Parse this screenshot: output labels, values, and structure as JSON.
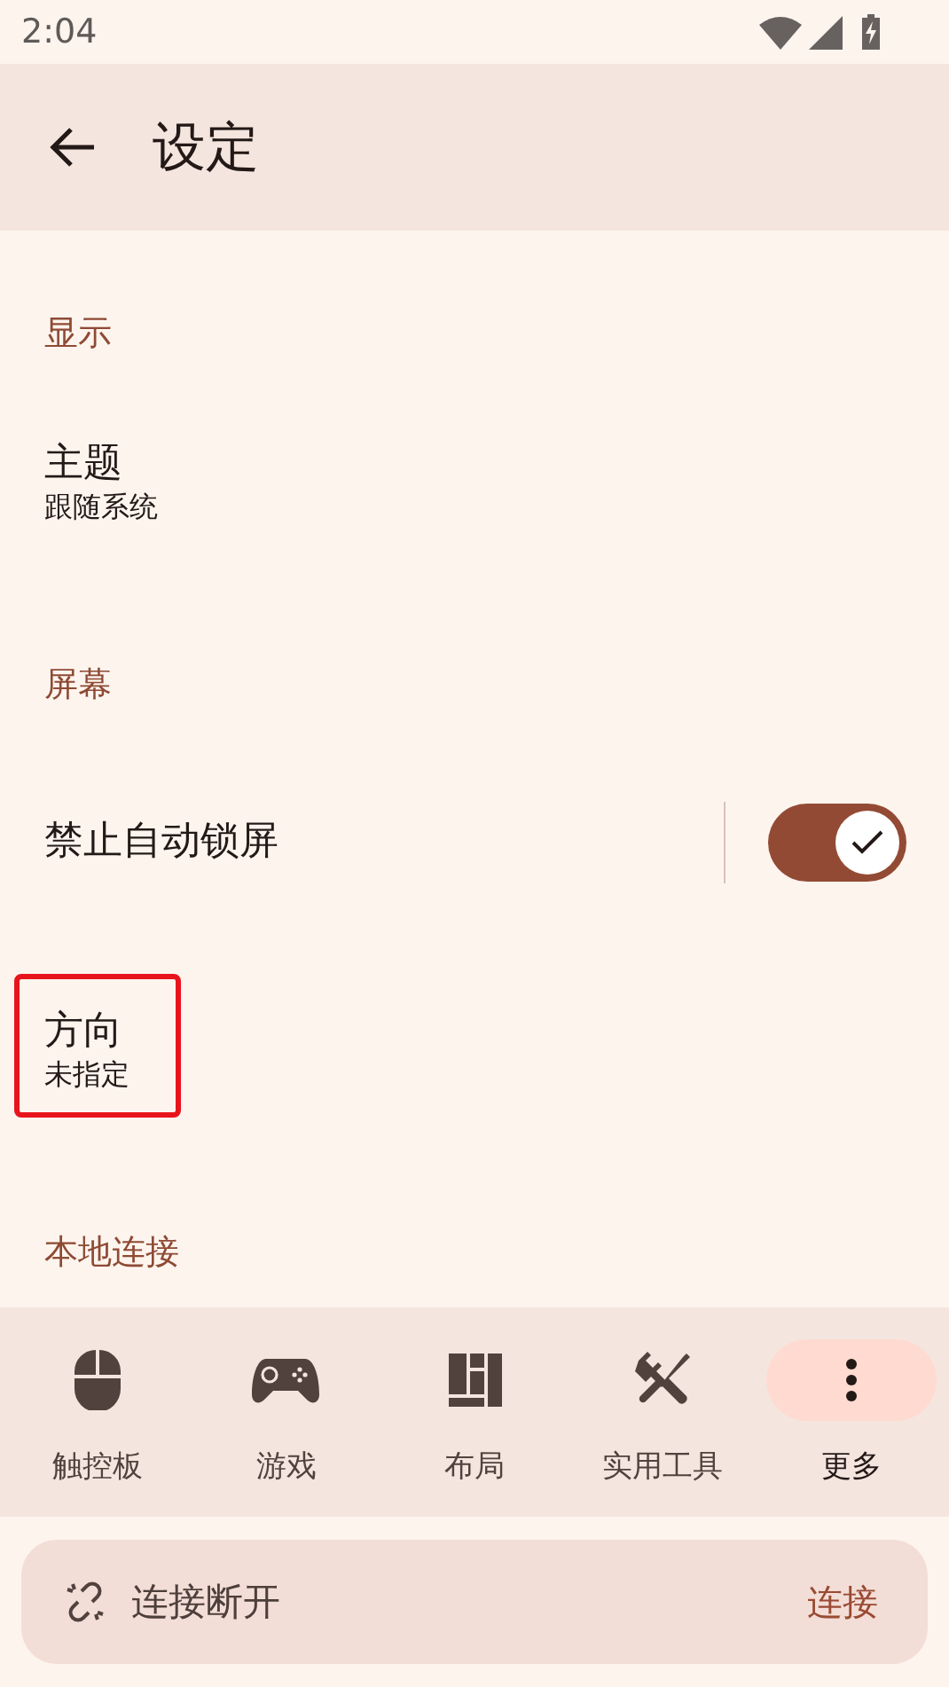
{
  "status_bar": {
    "time": "2:04"
  },
  "app_bar": {
    "title": "设定"
  },
  "sections": [
    {
      "header": "显示",
      "items": [
        {
          "kind": "text",
          "title": "主题",
          "summary": "跟随系统",
          "highlighted": false
        }
      ]
    },
    {
      "header": "屏幕",
      "items": [
        {
          "kind": "switch",
          "title": "禁止自动锁屏",
          "on": true
        },
        {
          "kind": "text",
          "title": "方向",
          "summary": "未指定",
          "highlighted": true
        }
      ]
    },
    {
      "header": "本地连接"
    }
  ],
  "nav": [
    {
      "kind": "mouse",
      "label": "触控板",
      "selected": false
    },
    {
      "kind": "gamepad",
      "label": "游戏",
      "selected": false
    },
    {
      "kind": "layout",
      "label": "布局",
      "selected": false
    },
    {
      "kind": "tools",
      "label": "实用工具",
      "selected": false
    },
    {
      "kind": "more",
      "label": "更多",
      "selected": true
    }
  ],
  "connection": {
    "status": "连接断开",
    "action": "连接"
  }
}
